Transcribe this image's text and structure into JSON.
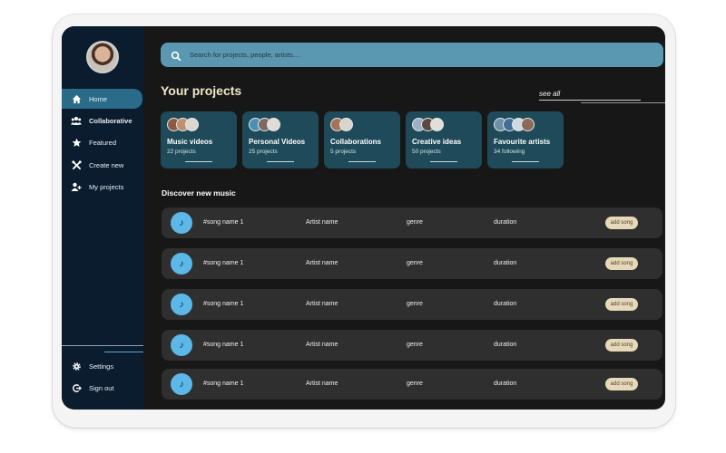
{
  "search": {
    "placeholder": "Search for projects, people, artists....",
    "icon": "search-icon"
  },
  "sidebar": {
    "items": [
      {
        "label": "Home",
        "icon": "home-icon",
        "active": true
      },
      {
        "label": "Collaborative",
        "icon": "group-icon"
      },
      {
        "label": "Featured",
        "icon": "star-icon"
      },
      {
        "label": "Create new",
        "icon": "tools-icon"
      },
      {
        "label": "My projects",
        "icon": "user-plus-icon"
      }
    ],
    "bottom": [
      {
        "label": "Settings",
        "icon": "gear-icon"
      },
      {
        "label": "Sign out",
        "icon": "sign-out-icon"
      }
    ]
  },
  "projects": {
    "title": "Your projects",
    "see_all": "see all",
    "cards": [
      {
        "name": "Music videos",
        "count": "22 projects"
      },
      {
        "name": "Personal Videos",
        "count": "25 projects"
      },
      {
        "name": "Collaborations",
        "count": "5 projects"
      },
      {
        "name": "Creative ideas",
        "count": "50 projects"
      },
      {
        "name": "Favourite artists",
        "count": "34 following"
      }
    ]
  },
  "discover": {
    "title": "Discover new music",
    "rows": [
      {
        "song": "#song name 1",
        "artist": "Artist name",
        "genre": "genre",
        "duration": "duration",
        "action": "add song"
      },
      {
        "song": "#song name 1",
        "artist": "Artist name",
        "genre": "genre",
        "duration": "duration",
        "action": "add song"
      },
      {
        "song": "#song name 1",
        "artist": "Artist name",
        "genre": "genre",
        "duration": "duration",
        "action": "add song"
      },
      {
        "song": "#song name 1",
        "artist": "Artist name",
        "genre": "genre",
        "duration": "duration",
        "action": "add song"
      },
      {
        "song": "#song name 1",
        "artist": "Artist name",
        "genre": "genre",
        "duration": "duration",
        "action": "add song"
      }
    ]
  },
  "colors": {
    "sidebar": "#0b1c2e",
    "active": "#2a6b8a",
    "search": "#5a97b1",
    "card": "#1f4a5a",
    "row": "#2f2f2f",
    "note": "#5bb8e8",
    "add_song": "#e6d8b8",
    "title": "#f2e6c8"
  }
}
